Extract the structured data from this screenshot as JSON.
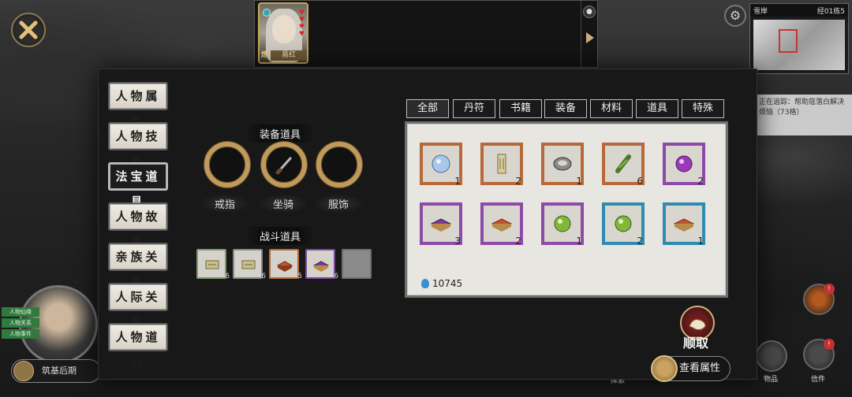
{
  "char_card": {
    "name": "易红",
    "stamp": "炼丸"
  },
  "left_tabs": [
    {
      "label": "人物属性",
      "active": false
    },
    {
      "label": "人物技能",
      "active": false
    },
    {
      "label": "法宝道具",
      "active": true
    },
    {
      "label": "人物故事",
      "active": false
    },
    {
      "label": "亲族关系",
      "active": false
    },
    {
      "label": "人际关系",
      "active": false
    },
    {
      "label": "人物道心",
      "active": false
    }
  ],
  "equipment": {
    "title": "装备道具",
    "slots": [
      {
        "label": "戒指",
        "icon": "empty-ring-icon"
      },
      {
        "label": "坐骑",
        "icon": "sword-mount-icon"
      },
      {
        "label": "服饰",
        "icon": "empty-ring-icon"
      }
    ]
  },
  "battle": {
    "title": "战斗道具",
    "items": [
      {
        "icon": "talisman-icon",
        "count": "6",
        "color": "#7a9c6a"
      },
      {
        "icon": "talisman-icon",
        "count": "6",
        "color": "#9a9a9a"
      },
      {
        "icon": "red-box-icon",
        "count": "5",
        "color": "#b86a3a"
      },
      {
        "icon": "purple-box-icon",
        "count": "6",
        "color": "#7a4a9a"
      },
      {
        "icon": "",
        "count": "",
        "color": "#6f6f6f"
      }
    ]
  },
  "filters": [
    "全部",
    "丹符",
    "书籍",
    "装备",
    "材料",
    "道具",
    "特殊"
  ],
  "inventory": {
    "items": [
      {
        "icon": "blue-orb-icon",
        "count": "1",
        "frame": "#b8693a"
      },
      {
        "icon": "scroll-icon",
        "count": "2",
        "frame": "#b8693a"
      },
      {
        "icon": "silver-ring-icon",
        "count": "1",
        "frame": "#b8693a"
      },
      {
        "icon": "green-herb-icon",
        "count": "6",
        "frame": "#b8693a"
      },
      {
        "icon": "purple-orb-icon",
        "count": "2",
        "frame": "#8e4aa8"
      },
      {
        "icon": "purple-box-icon",
        "count": "3",
        "frame": "#8e4aa8"
      },
      {
        "icon": "red-box-icon",
        "count": "2",
        "frame": "#8e4aa8"
      },
      {
        "icon": "green-orb-icon",
        "count": "1",
        "frame": "#8e4aa8"
      },
      {
        "icon": "green-orb-icon",
        "count": "2",
        "frame": "#2f8bb0"
      },
      {
        "icon": "red-box-icon",
        "count": "1",
        "frame": "#2f8bb0"
      }
    ],
    "currency": "10745"
  },
  "actions": {
    "loot": "顺取",
    "view_attr": "查看属性"
  },
  "quest_text": "正在追踪：帮助寇落白解决烦恼（73格）",
  "minimap_header": [
    "雪岸",
    "经01练5"
  ],
  "bottom_left_btn": "筑基后期",
  "green_tags": [
    "人物仙缘",
    "人物关系",
    "人物事件"
  ],
  "right_labels": [
    "物品",
    "信件",
    "探索"
  ]
}
